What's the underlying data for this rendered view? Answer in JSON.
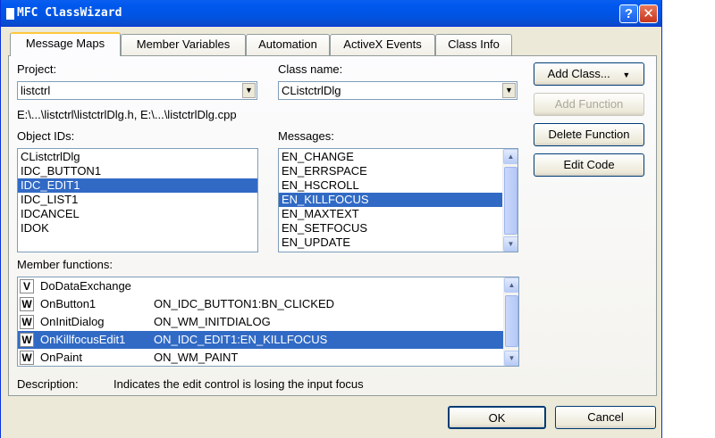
{
  "window": {
    "title": "MFC ClassWizard",
    "help_button": "?",
    "close_button": "✕"
  },
  "tabs": [
    "Message Maps",
    "Member Variables",
    "Automation",
    "ActiveX Events",
    "Class Info"
  ],
  "project": {
    "label": "Project:",
    "value": "listctrl"
  },
  "class_name": {
    "label": "Class name:",
    "value": "CListctrlDlg"
  },
  "file_path": "E:\\...\\listctrl\\listctrlDlg.h, E:\\...\\listctrlDlg.cpp",
  "object_ids": {
    "label": "Object IDs:",
    "items": [
      "CListctrlDlg",
      "IDC_BUTTON1",
      "IDC_EDIT1",
      "IDC_LIST1",
      "IDCANCEL",
      "IDOK"
    ],
    "selected": "IDC_EDIT1"
  },
  "messages": {
    "label": "Messages:",
    "items": [
      "EN_CHANGE",
      "EN_ERRSPACE",
      "EN_HSCROLL",
      "EN_KILLFOCUS",
      "EN_MAXTEXT",
      "EN_SETFOCUS",
      "EN_UPDATE"
    ],
    "selected": "EN_KILLFOCUS"
  },
  "member_functions": {
    "label": "Member functions:",
    "rows": [
      {
        "badge": "V",
        "name": "DoDataExchange",
        "message": ""
      },
      {
        "badge": "W",
        "name": "OnButton1",
        "message": "ON_IDC_BUTTON1:BN_CLICKED"
      },
      {
        "badge": "W",
        "name": "OnInitDialog",
        "message": "ON_WM_INITDIALOG"
      },
      {
        "badge": "W",
        "name": "OnKillfocusEdit1",
        "message": "ON_IDC_EDIT1:EN_KILLFOCUS"
      },
      {
        "badge": "W",
        "name": "OnPaint",
        "message": "ON_WM_PAINT"
      }
    ],
    "selected_index": 3
  },
  "description": {
    "label": "Description:",
    "text": "Indicates the edit control is losing the input focus"
  },
  "buttons": {
    "add_class": "Add Class...",
    "add_function": "Add Function",
    "delete_function": "Delete Function",
    "edit_code": "Edit Code",
    "ok": "OK",
    "cancel": "Cancel"
  },
  "scroll_arrows": {
    "up": "▲",
    "down": "▼"
  },
  "combo_arrow": "▼",
  "colors": {
    "selection": "#316ac5",
    "title_bar": "#0054e3",
    "dialog_bg": "#ece9d8"
  }
}
